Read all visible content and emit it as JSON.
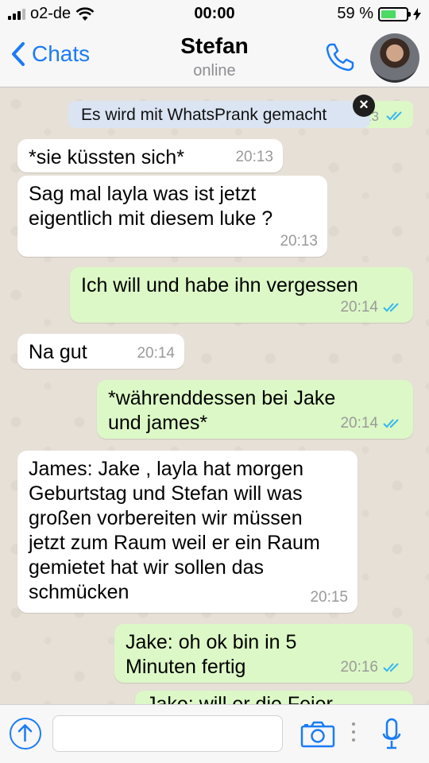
{
  "status_bar": {
    "carrier": "o2-de",
    "time": "00:00",
    "battery": "59 %",
    "battery_level": 0.59,
    "signal_bars": 3
  },
  "nav": {
    "back_label": "Chats",
    "contact_name": "Stefan",
    "contact_status": "online",
    "back_icon": "chevron-left-icon",
    "call_icon": "phone-icon"
  },
  "banner": {
    "text": "Es wird mit WhatsPrank gemacht",
    "close_icon": "close-icon",
    "hidden_time": "13"
  },
  "messages": [
    {
      "direction": "in",
      "text": "*sie küssten sich*",
      "time": "20:13"
    },
    {
      "direction": "in",
      "text": "Sag mal layla was ist jetzt eigentlich mit diesem luke ?",
      "time": "20:13"
    },
    {
      "direction": "out",
      "text": "Ich will und habe ihn vergessen",
      "time": "20:14",
      "read": true
    },
    {
      "direction": "in",
      "text": "Na gut",
      "time": "20:14"
    },
    {
      "direction": "out",
      "text": "*währenddessen bei Jake und james*",
      "time": "20:14",
      "read": true
    },
    {
      "direction": "in",
      "text": "James: Jake , layla hat morgen Geburtstag und Stefan will was großen vorbereiten wir müssen jetzt zum Raum weil er ein Raum gemietet hat wir sollen das schmücken",
      "time": "20:15"
    },
    {
      "direction": "out",
      "text": "Jake: oh ok bin in 5 Minuten fertig",
      "time": "20:16",
      "read": true
    },
    {
      "direction": "out",
      "text": "Jake: will er die Feier",
      "time": ""
    }
  ],
  "input_bar": {
    "placeholder": "",
    "upload_icon": "upload-arrow-icon",
    "camera_icon": "camera-icon",
    "mic_icon": "microphone-icon"
  },
  "colors": {
    "accent": "#1a7cf5",
    "outgoing_bubble": "#dcf8c6",
    "incoming_bubble": "#ffffff",
    "read_ticks": "#34b7f1",
    "battery_green": "#4cd964"
  }
}
